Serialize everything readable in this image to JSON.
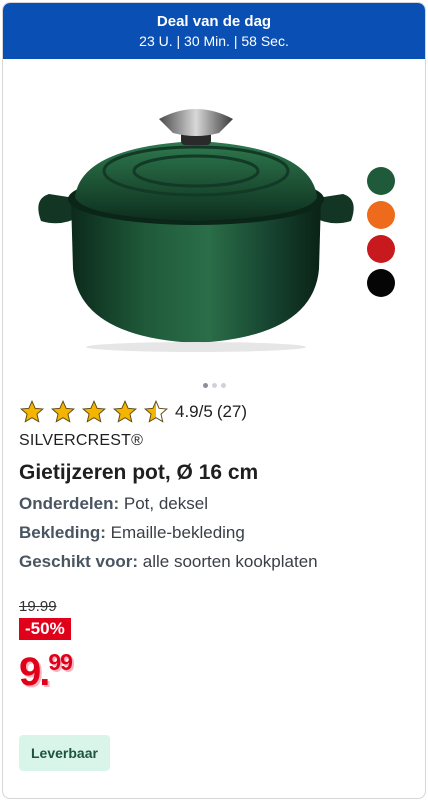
{
  "deal": {
    "title": "Deal van de dag",
    "timer": "23 U. | 30 Min. | 58 Sec."
  },
  "product": {
    "image_icon": "cast-iron-pot-image",
    "swatches": [
      "#1f5a3a",
      "#ee6b1c",
      "#c8191e",
      "#050505"
    ],
    "carousel": {
      "count": 3,
      "active": 1
    },
    "rating": {
      "value": "4.9/5",
      "count": "(27)",
      "stars": 4.5
    },
    "brand": "SILVERCREST®",
    "title": "Gietijzeren pot, Ø 16 cm",
    "attributes": [
      {
        "key": "Onderdelen",
        "value": "Pot, deksel"
      },
      {
        "key": "Bekleding",
        "value": "Emaille-bekleding"
      },
      {
        "key": "Geschikt voor",
        "value": "alle soorten kookplaten"
      }
    ],
    "old_price": "19.99",
    "discount": "-50%",
    "price_main": "9.",
    "price_cents": "99",
    "availability": "Leverbaar"
  },
  "colors": {
    "deal_bg": "#0a4fb3",
    "price_red": "#e1001a",
    "star_gold": "#f5b400",
    "availability_bg": "#d9f5e9"
  }
}
